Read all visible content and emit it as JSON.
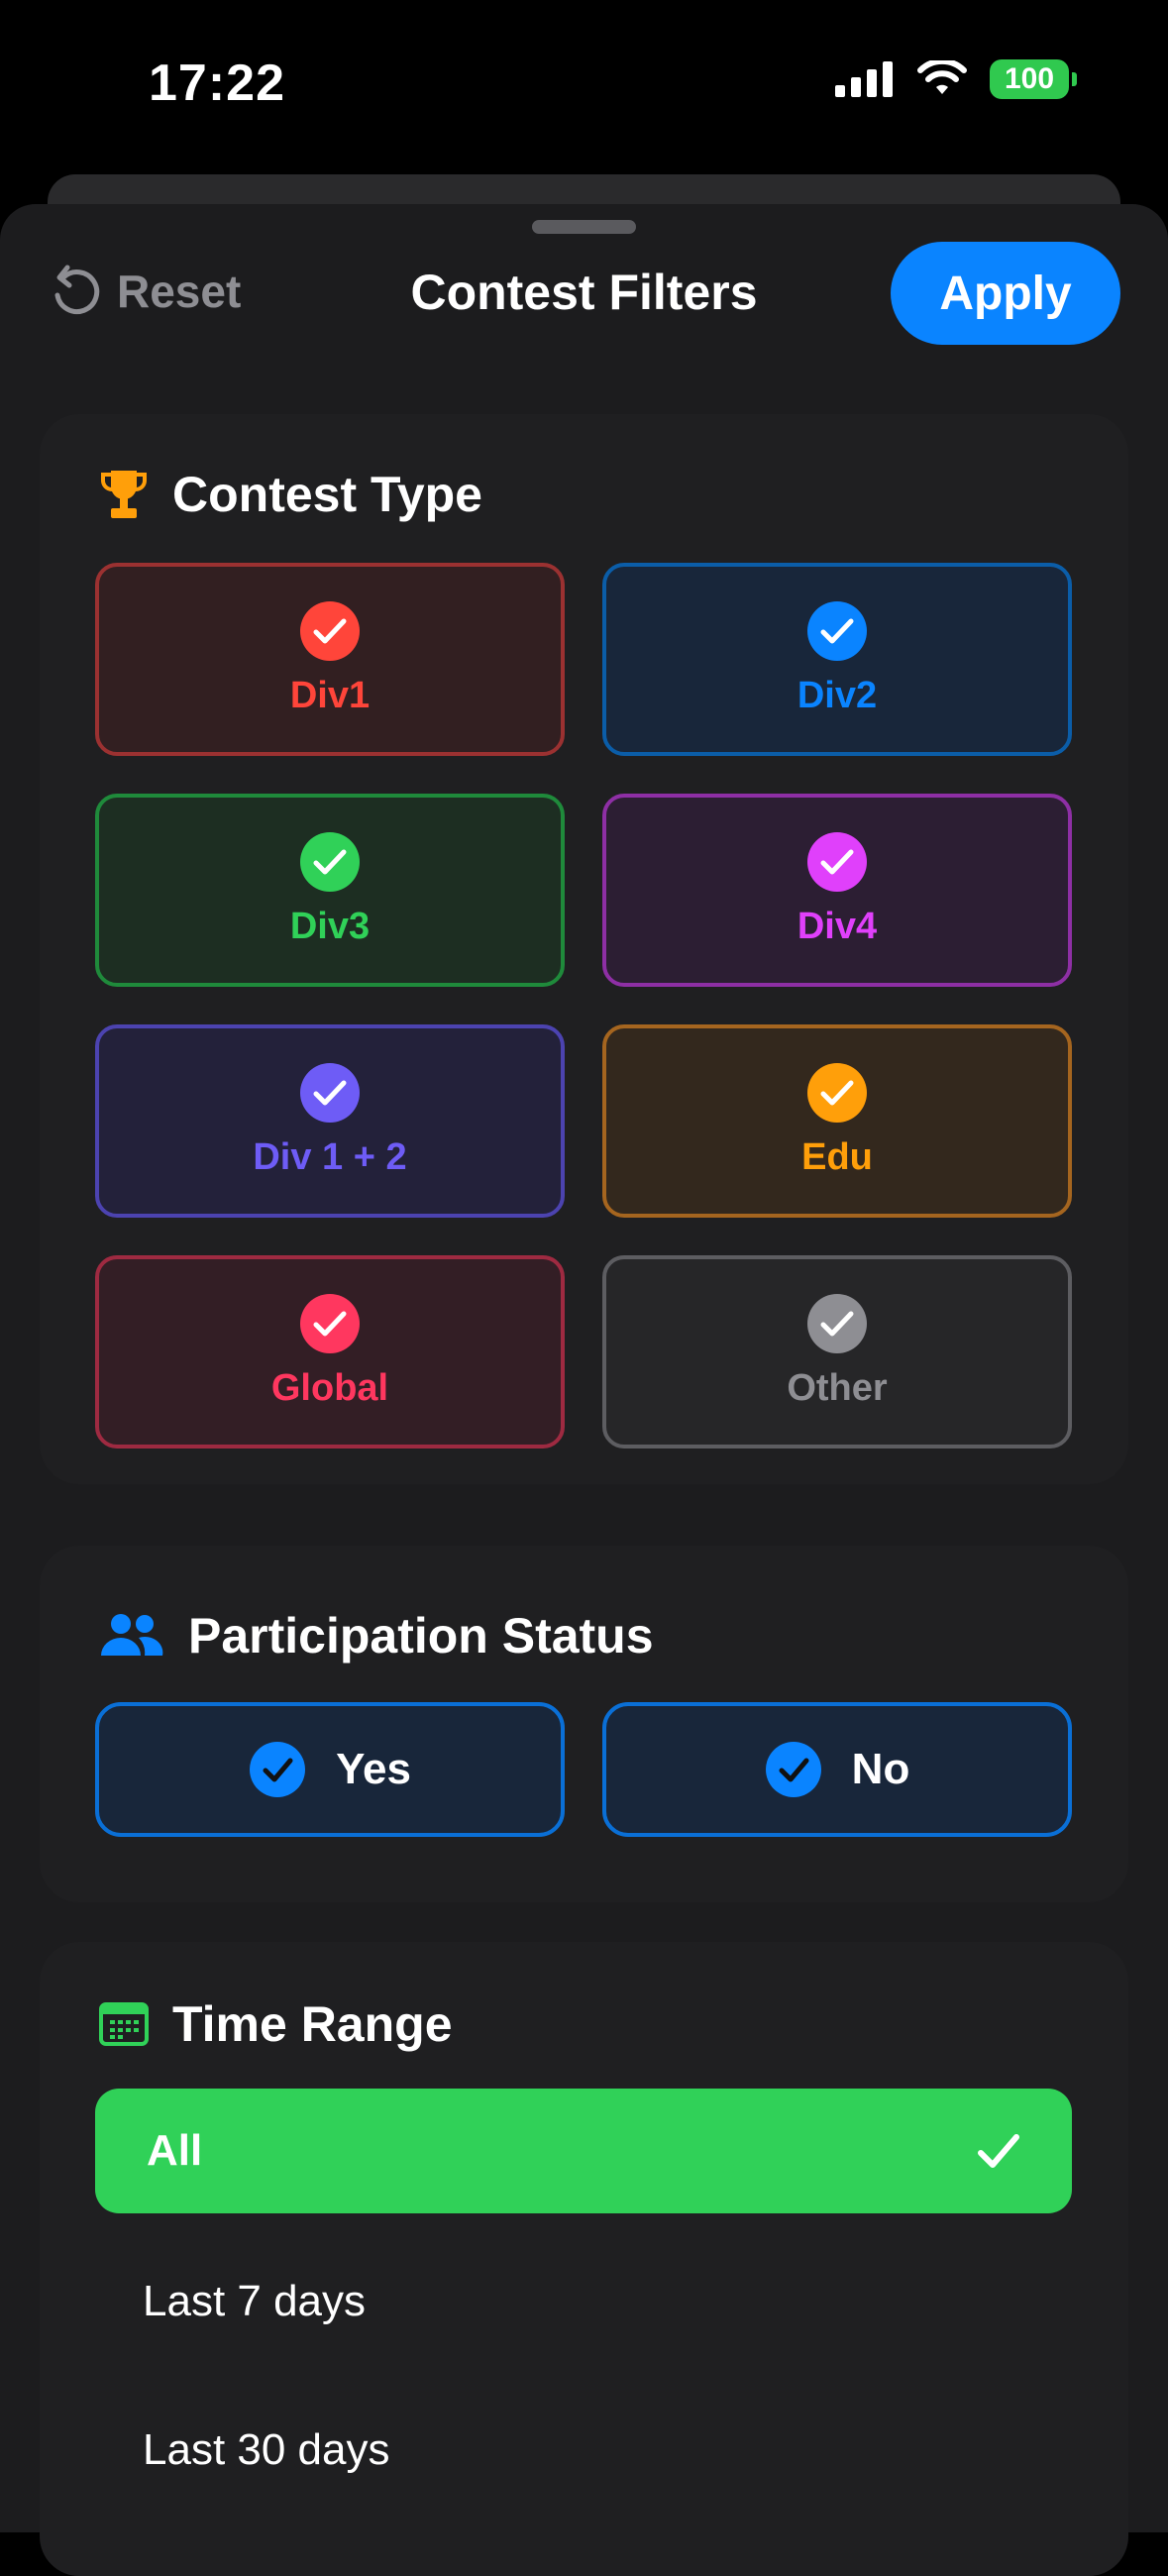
{
  "status_bar": {
    "time": "17:22",
    "battery": "100"
  },
  "nav": {
    "reset_label": "Reset",
    "title": "Contest Filters",
    "apply_label": "Apply"
  },
  "contest_type": {
    "title": "Contest Type",
    "items": [
      {
        "label": "Div1",
        "color": "#ff453a",
        "bg": "#321f21",
        "border": "#9b3131"
      },
      {
        "label": "Div2",
        "color": "#0a84ff",
        "bg": "#18263a",
        "border": "#0b5da8"
      },
      {
        "label": "Div3",
        "color": "#30d158",
        "bg": "#1d2e22",
        "border": "#1f8a3b"
      },
      {
        "label": "Div4",
        "color": "#e040fb",
        "bg": "#2c1e33",
        "border": "#8e2fa5"
      },
      {
        "label": "Div 1 + 2",
        "color": "#6e5cf6",
        "bg": "#23213a",
        "border": "#4c43b0"
      },
      {
        "label": "Edu",
        "color": "#ff9f0a",
        "bg": "#33281d",
        "border": "#a5651f"
      },
      {
        "label": "Global",
        "color": "#ff375f",
        "bg": "#331e25",
        "border": "#9e2a41"
      },
      {
        "label": "Other",
        "color": "#8e8e93",
        "bg": "#262628",
        "border": "#5d5d61"
      }
    ]
  },
  "participation": {
    "title": "Participation Status",
    "items": [
      {
        "label": "Yes"
      },
      {
        "label": "No"
      }
    ]
  },
  "time_range": {
    "title": "Time Range",
    "selected": "All",
    "options": [
      "Last 7 days",
      "Last 30 days"
    ]
  }
}
